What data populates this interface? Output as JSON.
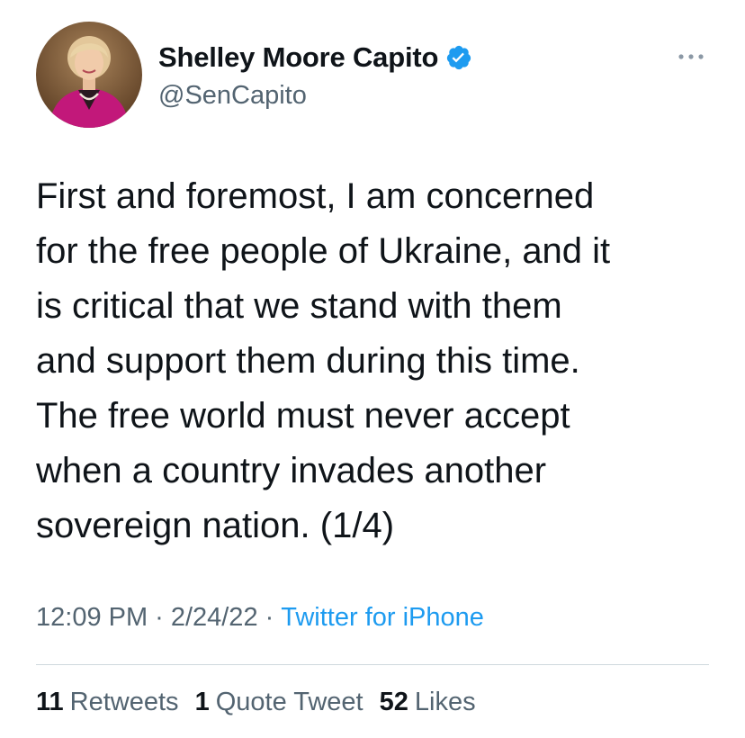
{
  "author": {
    "display_name": "Shelley Moore Capito",
    "handle": "@SenCapito",
    "verified": true
  },
  "tweet": {
    "text": "First and foremost, I am concerned\nfor the free people of Ukraine, and it\nis critical that we stand with them\nand support them during this time.\nThe free world must never accept\nwhen a country invades another\nsovereign nation. (1/4)",
    "time": "12:09 PM",
    "date": "2/24/22",
    "separator": "·",
    "source": "Twitter for iPhone"
  },
  "stats": {
    "retweets": {
      "count": "11",
      "label": "Retweets"
    },
    "quotes": {
      "count": "1",
      "label": "Quote Tweet"
    },
    "likes": {
      "count": "52",
      "label": "Likes"
    }
  },
  "colors": {
    "verified_badge": "#1d9bf0",
    "link": "#1d9bf0",
    "secondary_text": "#536471",
    "primary_text": "#0f1419"
  }
}
